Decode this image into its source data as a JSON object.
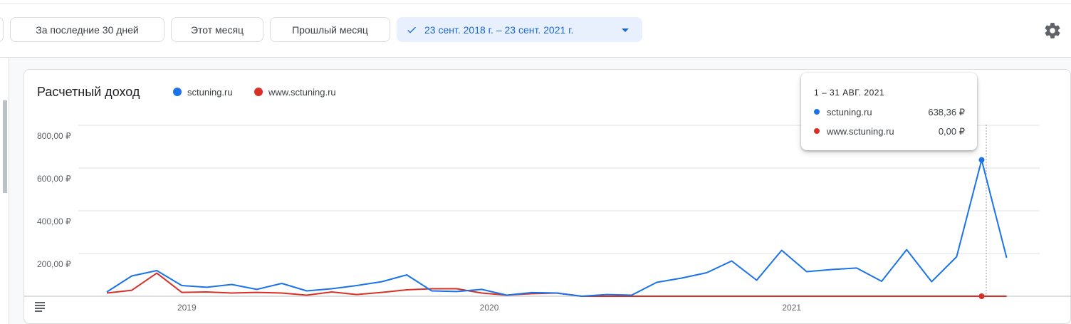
{
  "toolbar": {
    "chips": [
      {
        "label": "За последние 30 дней"
      },
      {
        "label": "Этот месяц"
      },
      {
        "label": "Прошлый месяц"
      }
    ],
    "date_range": {
      "label": "23 сент. 2018 г. – 23 сент. 2021 г."
    }
  },
  "card": {
    "title": "Расчетный доход",
    "legend": [
      {
        "name": "sctuning.ru",
        "color": "#1a73e8"
      },
      {
        "name": "www.sctuning.ru",
        "color": "#d93025"
      }
    ]
  },
  "tooltip": {
    "header": "1 – 31 АВГ. 2021",
    "rows": [
      {
        "name": "sctuning.ru",
        "value": "638,36 ₽",
        "color": "#1a73e8"
      },
      {
        "name": "www.sctuning.ru",
        "value": "0,00 ₽",
        "color": "#d93025"
      }
    ]
  },
  "chart_data": {
    "type": "line",
    "title": "Расчетный доход",
    "y_ticks": [
      "800,00 ₽",
      "600,00 ₽",
      "400,00 ₽",
      "200,00 ₽"
    ],
    "y_tick_values": [
      800,
      600,
      400,
      200
    ],
    "ylim": [
      0,
      800
    ],
    "x_ticks": [
      {
        "label": "2019",
        "index": 3.2
      },
      {
        "label": "2020",
        "index": 15.3
      },
      {
        "label": "2021",
        "index": 27.4
      }
    ],
    "x": [
      "2018-09",
      "2018-10",
      "2018-11",
      "2018-12",
      "2019-01",
      "2019-02",
      "2019-03",
      "2019-04",
      "2019-05",
      "2019-06",
      "2019-07",
      "2019-08",
      "2019-09",
      "2019-10",
      "2019-11",
      "2019-12",
      "2020-01",
      "2020-02",
      "2020-03",
      "2020-04",
      "2020-05",
      "2020-06",
      "2020-07",
      "2020-08",
      "2020-09",
      "2020-10",
      "2020-11",
      "2020-12",
      "2021-01",
      "2021-02",
      "2021-03",
      "2021-04",
      "2021-05",
      "2021-06",
      "2021-07",
      "2021-08",
      "2021-09"
    ],
    "series": [
      {
        "name": "sctuning.ru",
        "color": "#1a73e8",
        "values": [
          20,
          95,
          120,
          50,
          42,
          55,
          32,
          60,
          25,
          35,
          50,
          68,
          100,
          25,
          22,
          32,
          5,
          17,
          15,
          0,
          8,
          5,
          65,
          85,
          110,
          165,
          75,
          215,
          115,
          125,
          132,
          70,
          218,
          68,
          185,
          638,
          180
        ]
      },
      {
        "name": "www.sctuning.ru",
        "color": "#d93025",
        "values": [
          15,
          28,
          108,
          18,
          20,
          15,
          18,
          15,
          5,
          20,
          8,
          18,
          30,
          35,
          35,
          15,
          5,
          12,
          15,
          0,
          0,
          0,
          0,
          0,
          0,
          0,
          0,
          0,
          0,
          0,
          0,
          0,
          0,
          0,
          0,
          0,
          0
        ]
      }
    ],
    "highlight_index": 35,
    "grid": true
  }
}
